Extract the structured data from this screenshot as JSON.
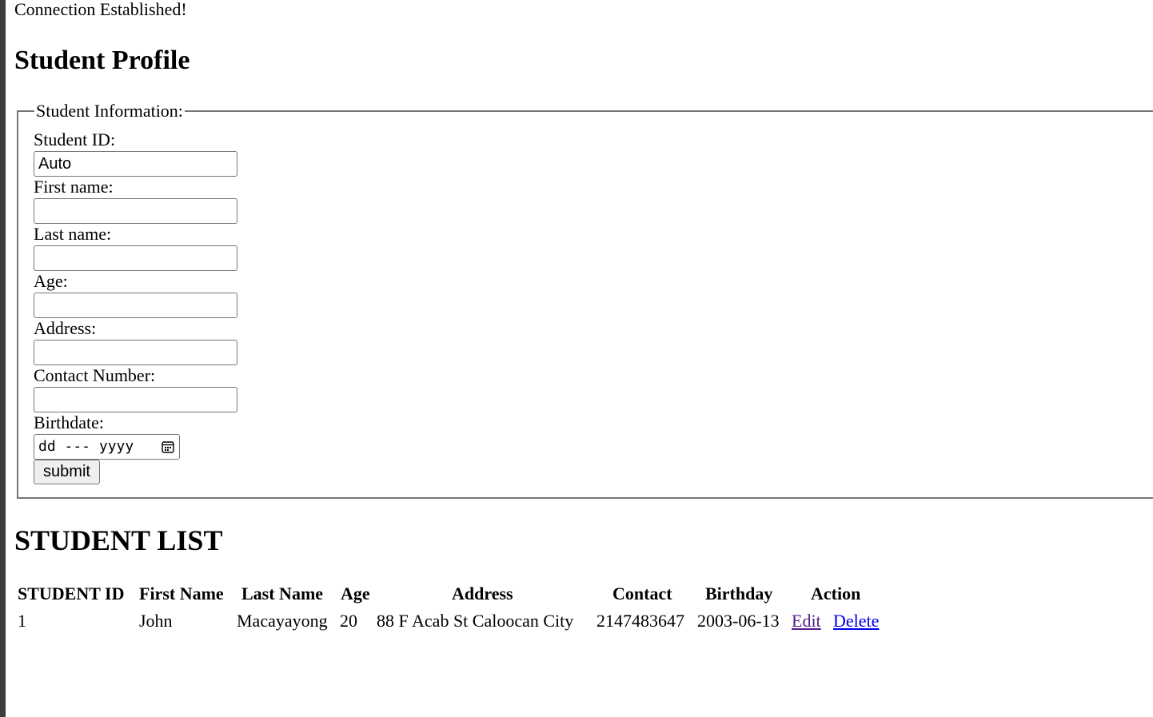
{
  "connection_message": "Connection Established!",
  "page_title": "Student Profile",
  "form": {
    "legend": "Student Information:",
    "fields": [
      {
        "label": "Student ID:",
        "value": "Auto"
      },
      {
        "label": "First name:",
        "value": ""
      },
      {
        "label": "Last name:",
        "value": ""
      },
      {
        "label": "Age:",
        "value": ""
      },
      {
        "label": "Address:",
        "value": ""
      },
      {
        "label": "Contact Number:",
        "value": ""
      }
    ],
    "birthdate_label": "Birthdate:",
    "birthdate_placeholder": "dd --- yyyy",
    "submit_label": "submit"
  },
  "list": {
    "title": "STUDENT LIST",
    "columns": [
      "STUDENT ID",
      "First Name",
      "Last Name",
      "Age",
      "Address",
      "Contact",
      "Birthday",
      "Action"
    ],
    "rows": [
      {
        "id": "1",
        "first_name": "John",
        "last_name": "Macayayong",
        "age": "20",
        "address": "88 F Acab St Caloocan City",
        "contact": "2147483647",
        "birthday": "2003-06-13",
        "edit_label": "Edit",
        "delete_label": "Delete"
      }
    ]
  },
  "colors": {
    "visited_link": "#551a8b",
    "link": "#0000ee",
    "border": "#767676"
  }
}
